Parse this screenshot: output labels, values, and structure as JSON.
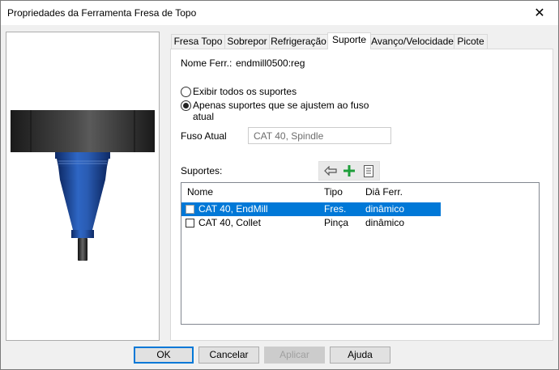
{
  "window": {
    "title": "Propriedades da Ferramenta Fresa de Topo",
    "close_glyph": "✕"
  },
  "tabs": [
    {
      "label": "Fresa Topo"
    },
    {
      "label": "Sobrepor"
    },
    {
      "label": "Refrigeração"
    },
    {
      "label": "Suporte",
      "active": true
    },
    {
      "label": "Avanço/Velocidade"
    },
    {
      "label": "Picote"
    }
  ],
  "holder_tab": {
    "tool_name_label": "Nome Ferr.:",
    "tool_name_value": "endmill0500:reg",
    "radio_all_label": "Exibir todos os suportes",
    "radio_fit_label_line1": "Apenas suportes que se ajustem ao fuso",
    "radio_fit_label_line2": "atual",
    "radio_selected": "fit",
    "spindle_label": "Fuso Atual",
    "spindle_value": "CAT 40, Spindle",
    "holders_label": "Suportes:",
    "toolbar_icons": [
      "undo-arrow-icon",
      "plus-icon",
      "list-icon"
    ],
    "columns": [
      "Nome",
      "Tipo",
      "Diâ Ferr."
    ],
    "rows": [
      {
        "name": "CAT 40, EndMill",
        "type": "Fres.",
        "diameter": "dinâmico",
        "selected": true
      },
      {
        "name": "CAT 40, Collet",
        "type": "Pinça",
        "diameter": "dinâmico",
        "selected": false
      }
    ]
  },
  "buttons": {
    "ok": "OK",
    "cancel": "Cancelar",
    "apply": "Aplicar",
    "help": "Ajuda"
  },
  "colors": {
    "selection": "#0078d7",
    "tool_body": "#1f4fa3",
    "add_icon": "#1e9e3a"
  }
}
